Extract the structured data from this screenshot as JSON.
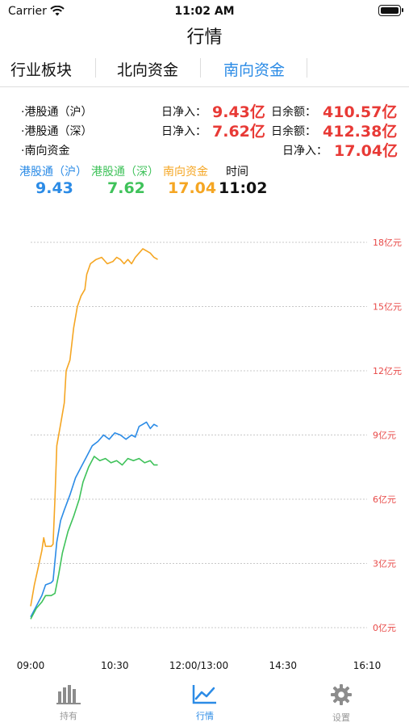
{
  "status": {
    "carrier": "Carrier",
    "time": "11:02 AM"
  },
  "nav": {
    "title": "行情"
  },
  "tabs": [
    {
      "label": "行业板块",
      "active": false
    },
    {
      "label": "北向资金",
      "active": false
    },
    {
      "label": "南向资金",
      "active": true
    }
  ],
  "flows": [
    {
      "name": "·港股通（沪）",
      "net_label": "日净入：",
      "net_value": "9.43亿",
      "balance_label": "日余额：",
      "balance_value": "410.57亿"
    },
    {
      "name": "·港股通（深）",
      "net_label": "日净入：",
      "net_value": "7.62亿",
      "balance_label": "日余额：",
      "balance_value": "412.38亿"
    },
    {
      "name": "·南向资金",
      "net_label": "日净入：",
      "net_value": "17.04亿"
    }
  ],
  "summary": {
    "items": [
      {
        "label": "港股通（沪）",
        "value": "9.43",
        "color": "#2b8be6"
      },
      {
        "label": "港股通（深）",
        "value": "7.62",
        "color": "#3fc25a"
      },
      {
        "label": "南向资金",
        "value": "17.04",
        "color": "#f5a623"
      },
      {
        "label": "时间",
        "value": "11:02",
        "color": "#111111"
      }
    ]
  },
  "chart_data": {
    "type": "line",
    "y_unit": "亿元",
    "ylim": [
      0,
      18
    ],
    "y_ticks": [
      "0亿元",
      "3亿元",
      "6亿元",
      "9亿元",
      "12亿元",
      "15亿元",
      "18亿元"
    ],
    "x_ticks": [
      "09:00",
      "10:30",
      "12:00/13:00",
      "14:30",
      "16:10"
    ],
    "x_minutes": [
      0,
      90,
      180,
      270,
      360
    ],
    "tick_color": "#e84a48",
    "grid": true,
    "series": [
      {
        "name": "南向资金",
        "color": "#f5a623",
        "points": [
          [
            0,
            1.0
          ],
          [
            4,
            2.0
          ],
          [
            8,
            2.8
          ],
          [
            12,
            3.6
          ],
          [
            14,
            4.2
          ],
          [
            16,
            3.8
          ],
          [
            22,
            3.8
          ],
          [
            24,
            3.9
          ],
          [
            26,
            6.0
          ],
          [
            28,
            8.5
          ],
          [
            32,
            9.5
          ],
          [
            36,
            10.5
          ],
          [
            38,
            12.0
          ],
          [
            42,
            12.5
          ],
          [
            46,
            14.0
          ],
          [
            50,
            15.0
          ],
          [
            54,
            15.5
          ],
          [
            58,
            15.8
          ],
          [
            60,
            16.5
          ],
          [
            64,
            17.0
          ],
          [
            70,
            17.2
          ],
          [
            76,
            17.3
          ],
          [
            82,
            17.0
          ],
          [
            88,
            17.1
          ],
          [
            92,
            17.3
          ],
          [
            96,
            17.2
          ],
          [
            100,
            17.0
          ],
          [
            104,
            17.2
          ],
          [
            108,
            17.0
          ],
          [
            112,
            17.3
          ],
          [
            116,
            17.5
          ],
          [
            120,
            17.7
          ],
          [
            124,
            17.6
          ],
          [
            128,
            17.5
          ],
          [
            132,
            17.3
          ],
          [
            136,
            17.2
          ]
        ]
      },
      {
        "name": "港股通（沪）",
        "color": "#2b8be6",
        "points": [
          [
            0,
            0.5
          ],
          [
            6,
            1.0
          ],
          [
            12,
            1.5
          ],
          [
            16,
            2.0
          ],
          [
            22,
            2.1
          ],
          [
            24,
            2.2
          ],
          [
            28,
            4.0
          ],
          [
            32,
            5.0
          ],
          [
            36,
            5.5
          ],
          [
            42,
            6.2
          ],
          [
            48,
            7.0
          ],
          [
            54,
            7.5
          ],
          [
            60,
            8.0
          ],
          [
            66,
            8.5
          ],
          [
            72,
            8.7
          ],
          [
            78,
            9.0
          ],
          [
            84,
            8.8
          ],
          [
            90,
            9.1
          ],
          [
            96,
            9.0
          ],
          [
            102,
            8.8
          ],
          [
            108,
            9.0
          ],
          [
            112,
            8.9
          ],
          [
            116,
            9.4
          ],
          [
            120,
            9.5
          ],
          [
            124,
            9.6
          ],
          [
            128,
            9.3
          ],
          [
            132,
            9.5
          ],
          [
            136,
            9.4
          ]
        ]
      },
      {
        "name": "港股通（深）",
        "color": "#3fc25a",
        "points": [
          [
            0,
            0.4
          ],
          [
            6,
            0.9
          ],
          [
            12,
            1.2
          ],
          [
            16,
            1.5
          ],
          [
            22,
            1.5
          ],
          [
            26,
            1.6
          ],
          [
            30,
            2.5
          ],
          [
            34,
            3.5
          ],
          [
            40,
            4.5
          ],
          [
            46,
            5.2
          ],
          [
            52,
            6.0
          ],
          [
            56,
            6.8
          ],
          [
            62,
            7.5
          ],
          [
            68,
            8.0
          ],
          [
            74,
            7.8
          ],
          [
            80,
            7.9
          ],
          [
            86,
            7.7
          ],
          [
            92,
            7.8
          ],
          [
            98,
            7.6
          ],
          [
            104,
            7.9
          ],
          [
            110,
            7.8
          ],
          [
            116,
            7.9
          ],
          [
            122,
            7.7
          ],
          [
            128,
            7.8
          ],
          [
            132,
            7.6
          ],
          [
            136,
            7.6
          ]
        ]
      }
    ]
  },
  "tabbar": [
    {
      "label": "持有",
      "icon": "bar-chart-icon",
      "active": false
    },
    {
      "label": "行情",
      "icon": "line-chart-icon",
      "active": true
    },
    {
      "label": "设置",
      "icon": "gear-icon",
      "active": false
    }
  ]
}
